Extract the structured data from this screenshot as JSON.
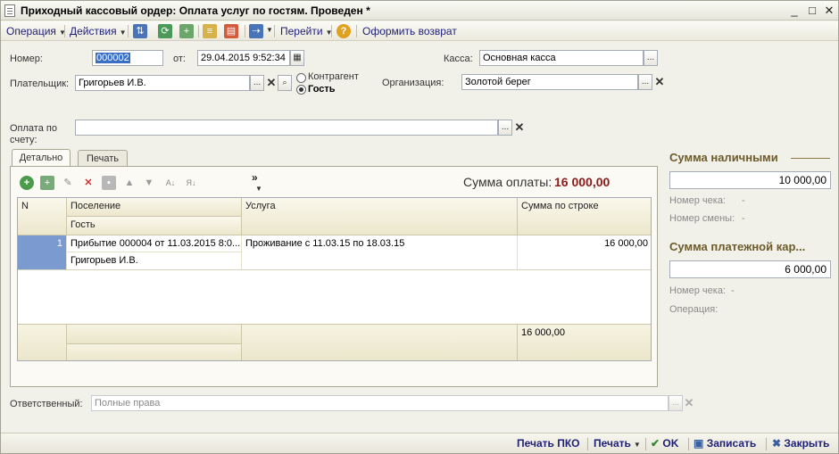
{
  "window": {
    "title": "Приходный кассовый ордер: Оплата услуг по гостям. Проведен *",
    "minimize_glyph": "_",
    "maximize_glyph": "□",
    "close_glyph": "✕"
  },
  "toolbar": {
    "operation_label": "Операция",
    "actions_label": "Действия",
    "goto_label": "Перейти",
    "help_glyph": "?",
    "refund_label": "Оформить возврат"
  },
  "header": {
    "number_label": "Номер:",
    "number_value": "000002",
    "date_label": "от:",
    "date_value": "29.04.2015  9:52:34",
    "kassa_label": "Касса:",
    "kassa_value": "Основная касса",
    "payer_label": "Плательщик:",
    "payer_value": "Григорьев И.В.",
    "radio_contractor": "Контрагент",
    "radio_guest": "Гость",
    "org_label": "Организация:",
    "org_value": "Золотой берег",
    "invoice_label": "Оплата по счету:",
    "invoice_value": "",
    "responsible_label": "Ответственный:",
    "responsible_value": "Полные права",
    "ellipsis": "...",
    "clear_glyph": "✕",
    "search_glyph": "🔍"
  },
  "tabs": {
    "details": "Детально",
    "print": "Печать"
  },
  "table_toolbar": {
    "more_glyph": "»",
    "payment_sum_label": "Сумма оплаты:",
    "payment_sum_value": "16 000,00"
  },
  "table": {
    "columns": {
      "n": "N",
      "settlement": "Поселение",
      "guest": "Гость",
      "service": "Услуга",
      "row_sum": "Сумма по строке"
    },
    "rows": [
      {
        "n": "1",
        "settlement": "Прибытие 000004 от 11.03.2015 8:0...",
        "guest": "Григорьев И.В.",
        "service": "Проживание с 11.03.15 по 18.03.15",
        "row_sum": "16 000,00"
      }
    ],
    "total_sum": "16 000,00"
  },
  "side": {
    "cash_heading": "Сумма наличными",
    "cash_value": "10 000,00",
    "cash_check_label": "Номер чека:",
    "cash_check_value": "-",
    "cash_shift_label": "Номер смены:",
    "cash_shift_value": "-",
    "card_heading": "Сумма платежной кар...",
    "card_value": "6 000,00",
    "card_check_label": "Номер чека:",
    "card_check_value": "-",
    "card_operation_label": "Операция:"
  },
  "footer": {
    "print_pko": "Печать ПКО",
    "print": "Печать",
    "ok": "OK",
    "save": "Записать",
    "close": "Закрыть"
  },
  "colors": {
    "accent_sum": "#8b1a1a",
    "link_blue": "#1e1e78",
    "selected_row": "#7a9ad0"
  }
}
